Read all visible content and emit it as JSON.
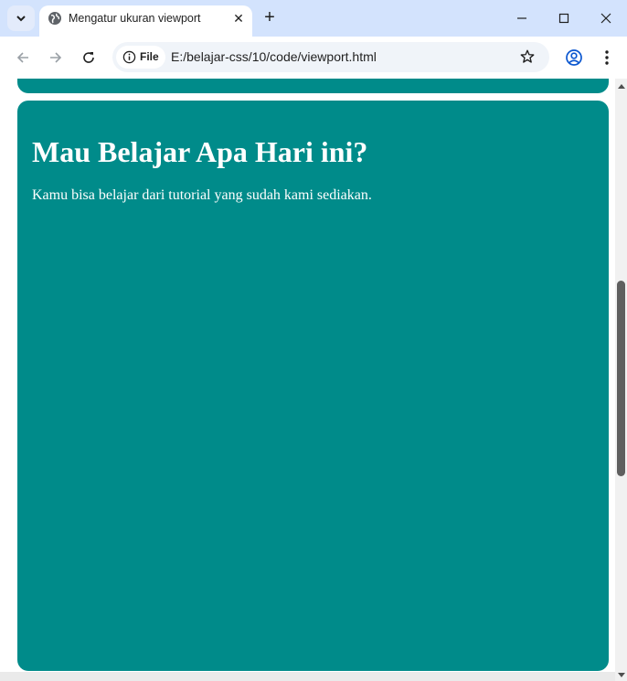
{
  "tab": {
    "title": "Mengatur ukuran viewport",
    "close": "✕"
  },
  "toolbar": {
    "security_chip_label": "File",
    "url": "E:/belajar-css/10/code/viewport.html"
  },
  "page": {
    "heading": "Mau Belajar Apa Hari ini?",
    "paragraph": "Kamu bisa belajar dari tutorial yang sudah kami sediakan."
  },
  "colors": {
    "card_bg": "#008b8a",
    "titlebar_bg": "#d3e3fd",
    "omnibox_bg": "#f0f4f9"
  },
  "icons": [
    "chevron-down-icon",
    "globe-icon",
    "close-icon",
    "plus-icon",
    "minimize-icon",
    "maximize-icon",
    "window-close-icon",
    "back-arrow-icon",
    "forward-arrow-icon",
    "reload-icon",
    "info-icon",
    "star-icon",
    "profile-icon",
    "more-vert-icon"
  ]
}
